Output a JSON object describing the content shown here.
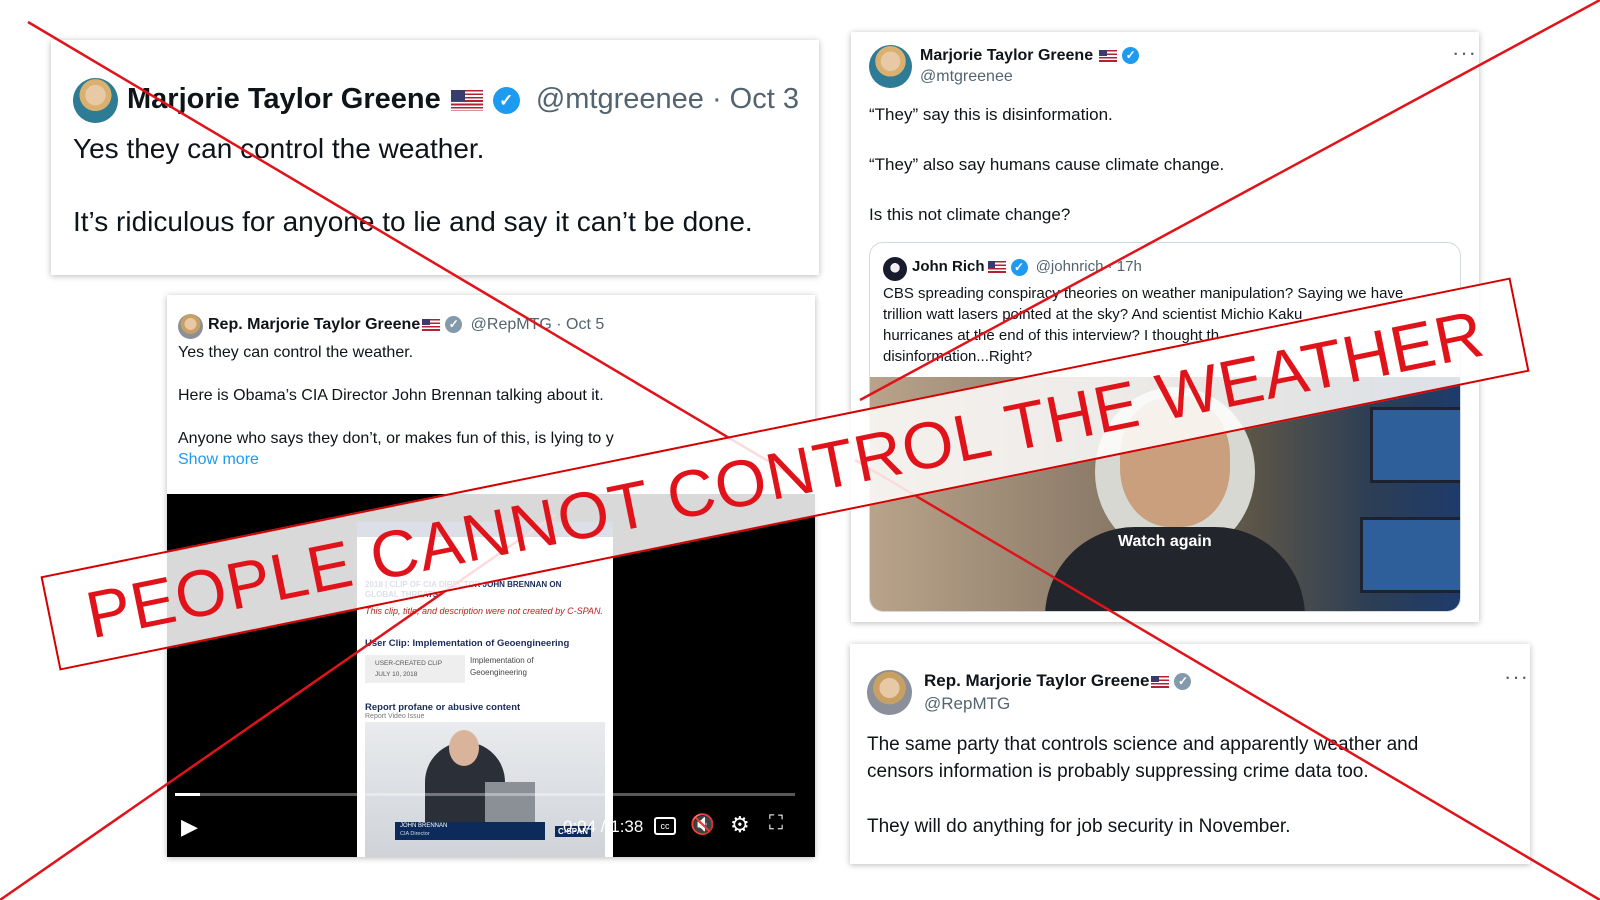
{
  "tweet1": {
    "name": "Marjorie Taylor Greene",
    "handle_date": "@mtgreenee · Oct 3",
    "line1": "Yes they can control the weather.",
    "line2": "It’s ridiculous for anyone to lie and say it can’t be done."
  },
  "tweet2": {
    "name": "Rep. Marjorie Taylor Greene",
    "handle_date": "@RepMTG · Oct 5",
    "line1": "Yes they can control the weather.",
    "line2": "Here is Obama’s CIA Director John Brennan talking about it.",
    "line3": "Anyone who says they don’t, or makes fun of this, is lying to y",
    "show_more": "Show more",
    "video": {
      "clip_header": "2018 | CLIP OF CIA DIRECTOR JOHN BRENNAN ON GLOBAL THREATS",
      "disclaimer": "This clip, title, and description were not created by C-SPAN.",
      "user_clip": "User Clip: Implementation of Geoengineering",
      "badge": "USER-CREATED CLIP",
      "badge_date": "JULY 10, 2018",
      "clip_desc": "Implementation of Geoengineering",
      "report": "Report profane or abusive content",
      "report_sub": "Report Video Issue",
      "lower_third_name": "JOHN BRENNAN",
      "lower_third_title": "CIA Director",
      "cspan": "C-SPAN",
      "time": "0:04 / 1:38",
      "progress": 0.04
    }
  },
  "tweet3": {
    "name": "Marjorie Taylor Greene",
    "handle": "@mtgreenee",
    "more": "···",
    "line1": "“They” say this is disinformation.",
    "line2": "“They” also say humans cause climate change.",
    "line3": "Is this not climate change?",
    "quote": {
      "name": "John Rich",
      "handle_time": "@johnrich · 17h",
      "text1": "CBS spreading conspiracy theories on weather manipulation? Saying we have",
      "text2": "trillion watt lasers pointed at the sky? And scientist Michio Kaku",
      "text3": "hurricanes at the end of this interview? I thought th",
      "text4": "disinformation...Right?",
      "watch_again": "Watch again"
    }
  },
  "tweet4": {
    "name": "Rep. Marjorie Taylor Greene",
    "handle": "@RepMTG",
    "more": "···",
    "line1": "The same party that controls science and apparently weather and",
    "line2": "censors information is probably suppressing crime data too.",
    "line3": "They will do anything for job security in November."
  },
  "banner_text": "PEOPLE CANNOT CONTROL THE WEATHER",
  "colors": {
    "cross": "#e0131a",
    "link": "#1d9bf0",
    "handle": "#536471"
  }
}
